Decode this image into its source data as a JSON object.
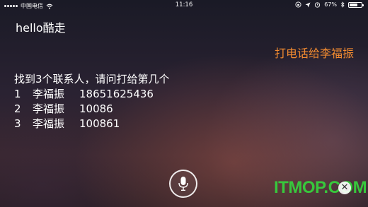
{
  "status_bar": {
    "carrier": "中国电信",
    "time": "11:16",
    "battery_text": "67%",
    "battery_level": 0.67,
    "icons": [
      "signal-dots",
      "wifi-icon",
      "orientation-lock-icon",
      "location-icon",
      "alarm-icon",
      "bluetooth-icon",
      "battery-icon"
    ]
  },
  "conversation": {
    "user_query": "hello酷走",
    "siri_reply": "打电话给李福振",
    "result_title": "找到3个联系人，请问打给第几个",
    "contacts": [
      {
        "index": "1",
        "name": "李福振",
        "number": "18651625436"
      },
      {
        "index": "2",
        "name": "李福振",
        "number": "10086"
      },
      {
        "index": "3",
        "name": "李福振",
        "number": "100861"
      }
    ]
  },
  "controls": {
    "mic_icon": "microphone-icon",
    "close_icon": "close-icon",
    "close_glyph": "✕"
  },
  "watermark": {
    "text": "ITMOP.COM",
    "color": "#37c83c"
  },
  "colors": {
    "siri_reply": "#f28b30",
    "text": "#ffffff"
  }
}
